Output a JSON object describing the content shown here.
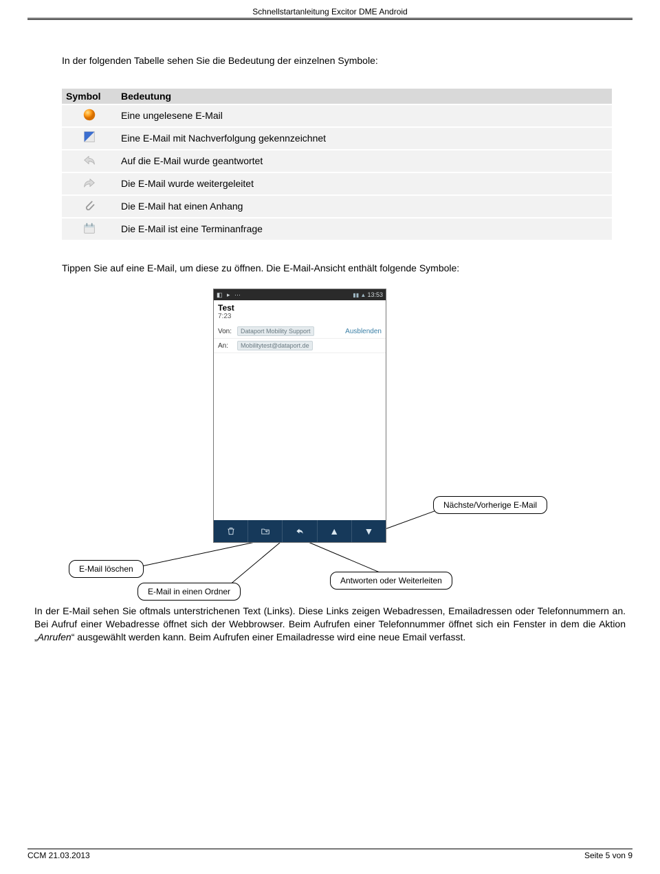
{
  "header": {
    "title": "Schnellstartanleitung Excitor DME Android"
  },
  "intro": "In der folgenden Tabelle sehen Sie die Bedeutung der einzelnen Symbole:",
  "table": {
    "col_symbol": "Symbol",
    "col_meaning": "Bedeutung",
    "rows": [
      {
        "icon": "ball-orange",
        "meaning": "Eine ungelesene E-Mail"
      },
      {
        "icon": "flag-blue",
        "meaning": "Eine E-Mail mit Nachverfolgung gekennzeichnet"
      },
      {
        "icon": "reply-icon",
        "meaning": "Auf die E-Mail wurde geantwortet"
      },
      {
        "icon": "forward-icon",
        "meaning": "Die E-Mail wurde weitergeleitet"
      },
      {
        "icon": "attachment-icon",
        "meaning": "Die E-Mail hat einen Anhang"
      },
      {
        "icon": "calendar-icon",
        "meaning": "Die E-Mail ist eine Terminanfrage"
      }
    ]
  },
  "para2": "Tippen Sie auf eine E-Mail, um diese zu öffnen. Die E-Mail-Ansicht enthält folgende Symbole:",
  "phone": {
    "time": "13:53",
    "subject": "Test",
    "sent_time": "7:23",
    "from_label": "Von:",
    "from_value": "Dataport Mobility Support",
    "hide": "Ausblenden",
    "to_label": "An:",
    "to_value": "Mobilitytest@dataport.de",
    "toolbar_icons": [
      "trash-icon",
      "folder-move-icon",
      "reply-icon",
      "up-icon",
      "down-icon"
    ]
  },
  "callouts": {
    "next_prev": "Nächste/Vorherige E-Mail",
    "delete": "E-Mail löschen",
    "move": "E-Mail in einen Ordner",
    "reply_fwd": "Antworten oder Weiterleiten"
  },
  "para3_parts": {
    "a": "In der E-Mail sehen Sie oftmals unterstrichenen Text (Links). Diese Links zeigen Webadressen, Emailadressen oder Telefonnummern an. Bei Aufruf einer Webadresse öffnet sich der Webbrowser. Beim Aufrufen einer Telefonnummer öffnet sich ein Fenster in dem die Aktion „",
    "b": "Anrufen",
    "c": "“ ausgewählt werden kann. Beim Aufrufen einer Emailadresse wird eine neue Email verfasst."
  },
  "footer": {
    "left": "CCM 21.03.2013",
    "right": "Seite 5 von 9"
  }
}
